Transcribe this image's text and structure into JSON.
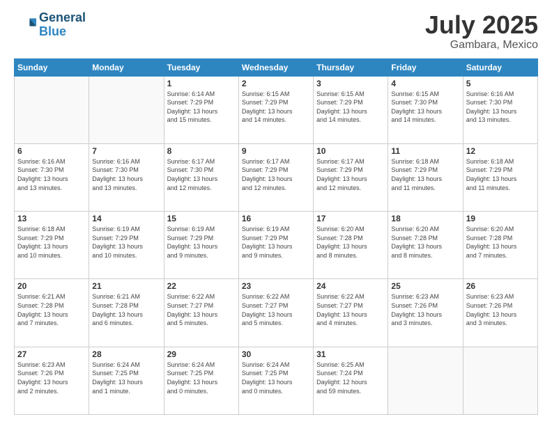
{
  "header": {
    "logo_line1": "General",
    "logo_line2": "Blue",
    "month": "July 2025",
    "location": "Gambara, Mexico"
  },
  "days_of_week": [
    "Sunday",
    "Monday",
    "Tuesday",
    "Wednesday",
    "Thursday",
    "Friday",
    "Saturday"
  ],
  "weeks": [
    [
      {
        "day": "",
        "info": ""
      },
      {
        "day": "",
        "info": ""
      },
      {
        "day": "1",
        "info": "Sunrise: 6:14 AM\nSunset: 7:29 PM\nDaylight: 13 hours\nand 15 minutes."
      },
      {
        "day": "2",
        "info": "Sunrise: 6:15 AM\nSunset: 7:29 PM\nDaylight: 13 hours\nand 14 minutes."
      },
      {
        "day": "3",
        "info": "Sunrise: 6:15 AM\nSunset: 7:29 PM\nDaylight: 13 hours\nand 14 minutes."
      },
      {
        "day": "4",
        "info": "Sunrise: 6:15 AM\nSunset: 7:30 PM\nDaylight: 13 hours\nand 14 minutes."
      },
      {
        "day": "5",
        "info": "Sunrise: 6:16 AM\nSunset: 7:30 PM\nDaylight: 13 hours\nand 13 minutes."
      }
    ],
    [
      {
        "day": "6",
        "info": "Sunrise: 6:16 AM\nSunset: 7:30 PM\nDaylight: 13 hours\nand 13 minutes."
      },
      {
        "day": "7",
        "info": "Sunrise: 6:16 AM\nSunset: 7:30 PM\nDaylight: 13 hours\nand 13 minutes."
      },
      {
        "day": "8",
        "info": "Sunrise: 6:17 AM\nSunset: 7:30 PM\nDaylight: 13 hours\nand 12 minutes."
      },
      {
        "day": "9",
        "info": "Sunrise: 6:17 AM\nSunset: 7:29 PM\nDaylight: 13 hours\nand 12 minutes."
      },
      {
        "day": "10",
        "info": "Sunrise: 6:17 AM\nSunset: 7:29 PM\nDaylight: 13 hours\nand 12 minutes."
      },
      {
        "day": "11",
        "info": "Sunrise: 6:18 AM\nSunset: 7:29 PM\nDaylight: 13 hours\nand 11 minutes."
      },
      {
        "day": "12",
        "info": "Sunrise: 6:18 AM\nSunset: 7:29 PM\nDaylight: 13 hours\nand 11 minutes."
      }
    ],
    [
      {
        "day": "13",
        "info": "Sunrise: 6:18 AM\nSunset: 7:29 PM\nDaylight: 13 hours\nand 10 minutes."
      },
      {
        "day": "14",
        "info": "Sunrise: 6:19 AM\nSunset: 7:29 PM\nDaylight: 13 hours\nand 10 minutes."
      },
      {
        "day": "15",
        "info": "Sunrise: 6:19 AM\nSunset: 7:29 PM\nDaylight: 13 hours\nand 9 minutes."
      },
      {
        "day": "16",
        "info": "Sunrise: 6:19 AM\nSunset: 7:29 PM\nDaylight: 13 hours\nand 9 minutes."
      },
      {
        "day": "17",
        "info": "Sunrise: 6:20 AM\nSunset: 7:28 PM\nDaylight: 13 hours\nand 8 minutes."
      },
      {
        "day": "18",
        "info": "Sunrise: 6:20 AM\nSunset: 7:28 PM\nDaylight: 13 hours\nand 8 minutes."
      },
      {
        "day": "19",
        "info": "Sunrise: 6:20 AM\nSunset: 7:28 PM\nDaylight: 13 hours\nand 7 minutes."
      }
    ],
    [
      {
        "day": "20",
        "info": "Sunrise: 6:21 AM\nSunset: 7:28 PM\nDaylight: 13 hours\nand 7 minutes."
      },
      {
        "day": "21",
        "info": "Sunrise: 6:21 AM\nSunset: 7:28 PM\nDaylight: 13 hours\nand 6 minutes."
      },
      {
        "day": "22",
        "info": "Sunrise: 6:22 AM\nSunset: 7:27 PM\nDaylight: 13 hours\nand 5 minutes."
      },
      {
        "day": "23",
        "info": "Sunrise: 6:22 AM\nSunset: 7:27 PM\nDaylight: 13 hours\nand 5 minutes."
      },
      {
        "day": "24",
        "info": "Sunrise: 6:22 AM\nSunset: 7:27 PM\nDaylight: 13 hours\nand 4 minutes."
      },
      {
        "day": "25",
        "info": "Sunrise: 6:23 AM\nSunset: 7:26 PM\nDaylight: 13 hours\nand 3 minutes."
      },
      {
        "day": "26",
        "info": "Sunrise: 6:23 AM\nSunset: 7:26 PM\nDaylight: 13 hours\nand 3 minutes."
      }
    ],
    [
      {
        "day": "27",
        "info": "Sunrise: 6:23 AM\nSunset: 7:26 PM\nDaylight: 13 hours\nand 2 minutes."
      },
      {
        "day": "28",
        "info": "Sunrise: 6:24 AM\nSunset: 7:25 PM\nDaylight: 13 hours\nand 1 minute."
      },
      {
        "day": "29",
        "info": "Sunrise: 6:24 AM\nSunset: 7:25 PM\nDaylight: 13 hours\nand 0 minutes."
      },
      {
        "day": "30",
        "info": "Sunrise: 6:24 AM\nSunset: 7:25 PM\nDaylight: 13 hours\nand 0 minutes."
      },
      {
        "day": "31",
        "info": "Sunrise: 6:25 AM\nSunset: 7:24 PM\nDaylight: 12 hours\nand 59 minutes."
      },
      {
        "day": "",
        "info": ""
      },
      {
        "day": "",
        "info": ""
      }
    ]
  ]
}
